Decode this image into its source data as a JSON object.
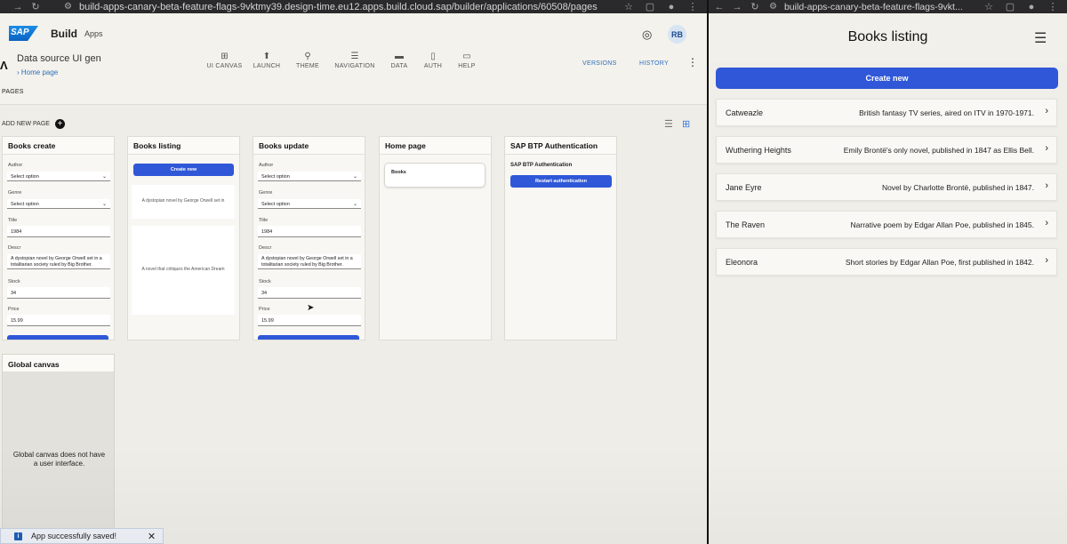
{
  "left_browser": {
    "url": "build-apps-canary-beta-feature-flags-9vktmy39.design-time.eu12.apps.build.cloud.sap/builder/applications/60508/pages"
  },
  "shell": {
    "brand": "Build",
    "brand_sub": "Apps",
    "avatar": "RB"
  },
  "app": {
    "name": "Data source UI gen",
    "breadcrumb": "Home page",
    "tools": [
      {
        "icon": "ui-canvas-icon",
        "glyph": "⊞",
        "label": "UI CANVAS"
      },
      {
        "icon": "launch-icon",
        "glyph": "⬆",
        "label": "LAUNCH"
      },
      {
        "icon": "theme-icon",
        "glyph": "⚲",
        "label": "THEME"
      },
      {
        "icon": "navigation-icon",
        "glyph": "☰",
        "label": "NAVIGATION"
      },
      {
        "icon": "data-icon",
        "glyph": "▬",
        "label": "DATA"
      },
      {
        "icon": "auth-icon",
        "glyph": "▯",
        "label": "AUTH"
      },
      {
        "icon": "help-icon",
        "glyph": "▭",
        "label": "HELP"
      }
    ],
    "versions": "VERSIONS",
    "history": "HISTORY"
  },
  "pages": {
    "section_label": "PAGES",
    "add_new": "ADD NEW PAGE",
    "cards": {
      "books_create": {
        "title": "Books create",
        "author_label": "Author",
        "author_value": "Select option",
        "genre_label": "Genre",
        "genre_value": "Select option",
        "title_label": "Title",
        "title_value": "1984",
        "descr_label": "Descr",
        "descr_value": "A dystopian novel by George Orwell set in a totalitarian society ruled by Big Brother.",
        "stock_label": "Stock",
        "stock_value": "34",
        "price_label": "Price",
        "price_value": "15.99"
      },
      "books_listing": {
        "title": "Books listing",
        "button": "Create new",
        "item1": "A dystopian novel by George Orwell set in",
        "item2": "A novel that critiques the American Dream"
      },
      "books_update": {
        "title": "Books update",
        "author_label": "Author",
        "author_value": "Select option",
        "genre_label": "Genre",
        "genre_value": "Select option",
        "title_label": "Title",
        "title_value": "1984",
        "descr_label": "Descr",
        "descr_value": "A dystopian novel by George Orwell set in a totalitarian society ruled by Big Brother.",
        "stock_label": "Stock",
        "stock_value": "34",
        "price_label": "Price",
        "price_value": "15.99"
      },
      "home_page": {
        "title": "Home page",
        "card": "Books"
      },
      "sap_btp": {
        "title": "SAP BTP Authentication",
        "inner_title": "SAP BTP Authentication",
        "button": "Restart authentication"
      }
    },
    "global_canvas": {
      "title": "Global canvas",
      "message": "Global canvas does not have a user interface."
    }
  },
  "toast": {
    "message": "App successfully saved!"
  },
  "right_browser": {
    "url": "build-apps-canary-beta-feature-flags-9vkt..."
  },
  "preview": {
    "title": "Books listing",
    "create_button": "Create new",
    "items": [
      {
        "name": "Catweazle",
        "desc": "British fantasy TV series, aired on ITV in 1970-1971."
      },
      {
        "name": "Wuthering Heights",
        "desc": "Emily Brontë's only novel, published in 1847 as Ellis Bell."
      },
      {
        "name": "Jane Eyre",
        "desc": "Novel by Charlotte Brontë, published in 1847."
      },
      {
        "name": "The Raven",
        "desc": "Narrative poem by Edgar Allan Poe, published in 1845."
      },
      {
        "name": "Eleonora",
        "desc": "Short stories by Edgar Allan Poe, first published in 1842."
      }
    ]
  },
  "colors": {
    "accent": "#2f57d8",
    "link": "#2f6fbd"
  }
}
